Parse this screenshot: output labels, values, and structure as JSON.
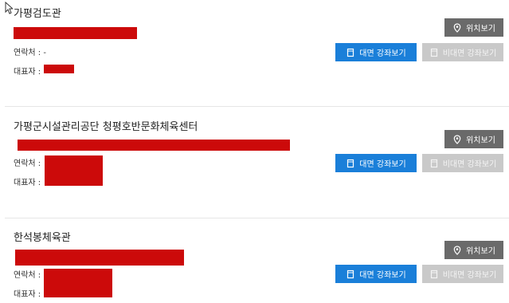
{
  "facilities": [
    {
      "name": "가평검도관",
      "contact_label": "연락처 :",
      "contact_value": "-",
      "rep_label": "대표자 :",
      "buttons": {
        "location": "위치보기",
        "offline": "대면 강좌보기",
        "online": "비대면 강좌보기"
      }
    },
    {
      "name": "가평군시설관리공단 청평호반문화체육센터",
      "contact_label": "연락처 :",
      "contact_value": "",
      "rep_label": "대표자 :",
      "buttons": {
        "location": "위치보기",
        "offline": "대면 강좌보기",
        "online": "비대면 강좌보기"
      }
    },
    {
      "name": "한석봉체육관",
      "contact_label": "연락처 :",
      "contact_value": "",
      "rep_label": "대표자 :",
      "buttons": {
        "location": "위치보기",
        "offline": "대면 강좌보기",
        "online": "비대면 강좌보기"
      }
    }
  ],
  "icons": {
    "location": "map-pin-icon",
    "lecture": "book-icon",
    "cursor": "mouse-cursor-icon"
  },
  "colors": {
    "location_btn": "#6a6a6a",
    "offline_btn": "#1a7fd9",
    "online_btn_disabled": "#c9c9c9",
    "redaction": "#cc0a0a"
  }
}
